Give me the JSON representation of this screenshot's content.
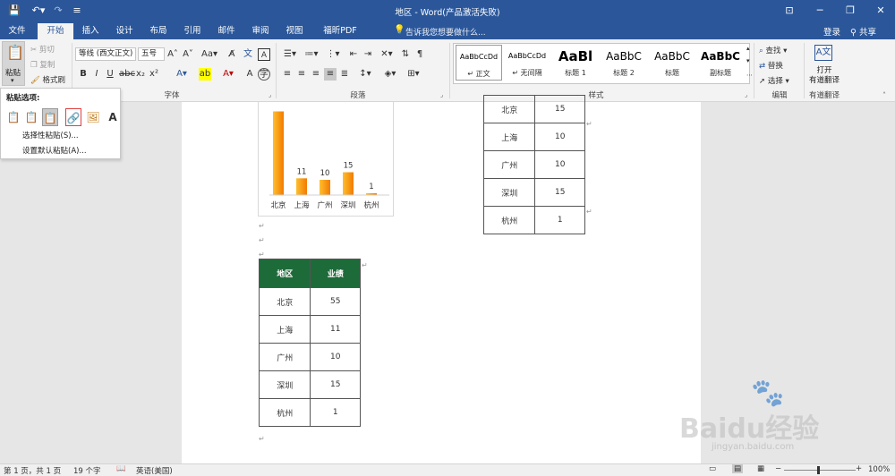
{
  "titlebar": {
    "title": "地区 - Word(产品激活失败)",
    "save_icon": "save-icon",
    "undo_icon": "undo-icon",
    "redo_icon": "redo-icon",
    "ribbon_display_icon": "ribbon-display-icon",
    "minimize_icon": "minimize-icon",
    "restore_icon": "restore-icon",
    "close_icon": "close-icon"
  },
  "tabs": [
    "文件",
    "开始",
    "插入",
    "设计",
    "布局",
    "引用",
    "邮件",
    "审阅",
    "视图",
    "福昕PDF"
  ],
  "active_tab": "开始",
  "tell_me": "告诉我您想要做什么...",
  "login": "登录",
  "share": "共享",
  "ribbon": {
    "clipboard": {
      "paste": "粘贴",
      "cut": "剪切",
      "copy": "复制",
      "format_painter": "格式刷"
    },
    "font": {
      "font_name": "等线 (西文正文)",
      "font_size": "五号",
      "group_label": "字体"
    },
    "paragraph": {
      "group_label": "段落"
    },
    "styles": {
      "group_label": "样式",
      "cards": [
        {
          "preview": "AaBbCcDd",
          "name": "↵ 正文"
        },
        {
          "preview": "AaBbCcDd",
          "name": "↵ 无间隔"
        },
        {
          "preview": "AaBl",
          "name": "标题 1"
        },
        {
          "preview": "AaBbC",
          "name": "标题 2"
        },
        {
          "preview": "AaBbC",
          "name": "标题"
        },
        {
          "preview": "AaBbC",
          "name": "副标题"
        }
      ]
    },
    "editing": {
      "find": "查找",
      "replace": "替换",
      "select": "选择",
      "group_label": "编辑"
    },
    "youdao": {
      "open": "打开",
      "translate": "有道翻译",
      "group_label": "有道翻译"
    }
  },
  "paste_panel": {
    "title": "粘贴选项:",
    "options": [
      "keep-source-formatting-icon",
      "merge-formatting-icon",
      "use-destination-style-icon",
      "link-icon",
      "picture-icon",
      "keep-text-only-icon"
    ],
    "selective_paste": "选择性粘贴(S)...",
    "set_default": "设置默认粘贴(A)..."
  },
  "chart_data": {
    "type": "bar",
    "categories": [
      "北京",
      "上海",
      "广州",
      "深圳",
      "杭州"
    ],
    "values": [
      55,
      11,
      10,
      15,
      1
    ],
    "data_labels": [
      "11",
      "10",
      "15",
      "1"
    ]
  },
  "table_top_right": {
    "rows": [
      [
        "北京",
        "15"
      ],
      [
        "上海",
        "10"
      ],
      [
        "广州",
        "10"
      ],
      [
        "深圳",
        "15"
      ],
      [
        "杭州",
        "1"
      ]
    ]
  },
  "table_main": {
    "headers": [
      "地区",
      "业绩"
    ],
    "rows": [
      [
        "北京",
        "55"
      ],
      [
        "上海",
        "11"
      ],
      [
        "广州",
        "10"
      ],
      [
        "深圳",
        "15"
      ],
      [
        "杭州",
        "1"
      ]
    ]
  },
  "statusbar": {
    "page": "第 1 页，共 1 页",
    "words": "19 个字",
    "language": "英语(美国)",
    "zoom": "100%"
  },
  "watermark": {
    "brand": "Baidu经验",
    "url": "jingyan.baidu.com"
  },
  "colors": {
    "accent": "#2b579a",
    "table_header": "#1e6b3a",
    "bar": "#f7a21c"
  }
}
